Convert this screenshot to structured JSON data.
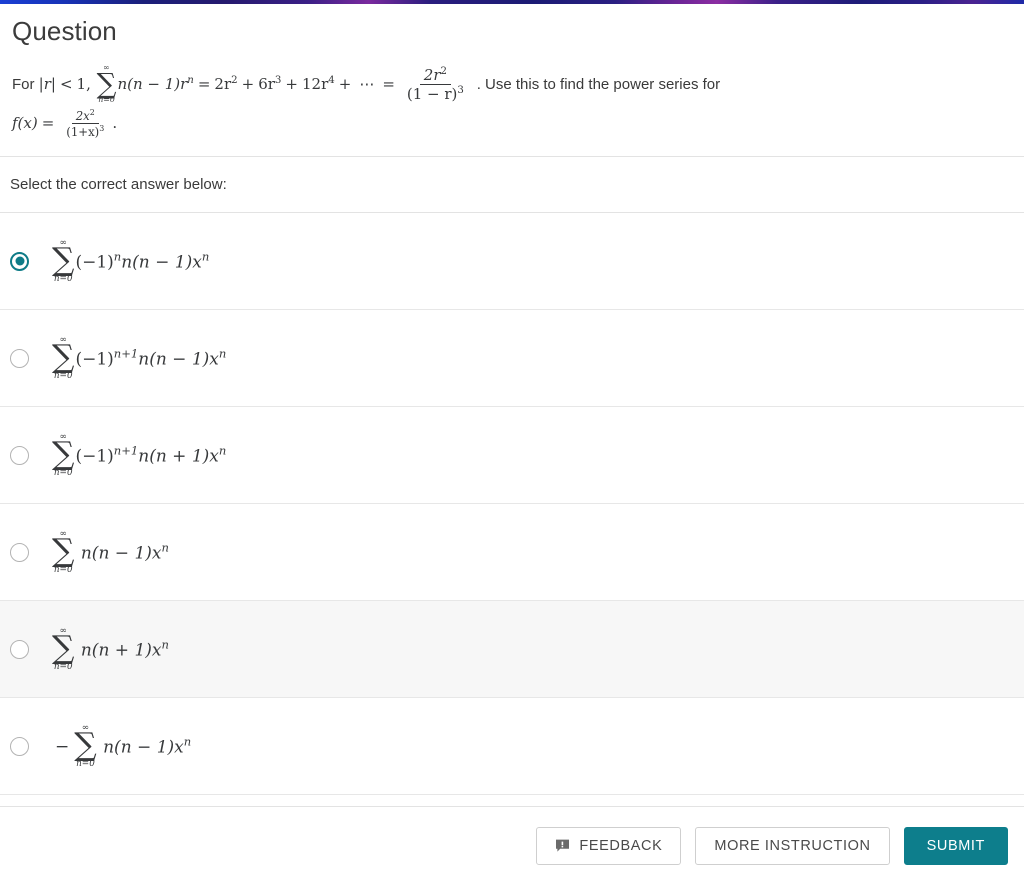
{
  "top_bar": {
    "gradient_from": "#1a3fd4",
    "gradient_mid": "#8b2da2",
    "gradient_to": "#1e2aa8"
  },
  "header": {
    "title": "Question"
  },
  "question": {
    "intro": "For",
    "condition_abs": "|r|",
    "condition_lt": "<",
    "condition_val": "1,",
    "sum_upper": "∞",
    "sum_lower": "n=0",
    "sum_sigma": "∑",
    "term_main": "n(n − 1)r",
    "term_main_sup": "n",
    "equals_1": "=",
    "series_t1": "2r",
    "series_t1_sup": "2",
    "plus_1": "+",
    "series_t2": "6r",
    "series_t2_sup": "3",
    "plus_2": "+",
    "series_t3": "12r",
    "series_t3_sup": "4",
    "plus_3": "+",
    "ellipsis": "⋯",
    "equals_2": "=",
    "frac_num": "2r",
    "frac_num_sup": "2",
    "frac_den": "(1 − r)",
    "frac_den_sup": "3",
    "sentence_tail": ". Use this to find the power series for",
    "fx_label": "f(x)",
    "fx_equals": "=",
    "fx_num": "2x",
    "fx_num_sup": "2",
    "fx_den": "(1+x)",
    "fx_den_sup": "3",
    "fx_period": "."
  },
  "prompt": {
    "text": "Select the correct answer below:"
  },
  "options": [
    {
      "id": "option-1",
      "selected": true,
      "hovered": false,
      "sum_upper": "∞",
      "sum_lower": "n=0",
      "prefix": "",
      "sign_base": "(−1)",
      "sign_exp": "n",
      "body": "n(n − 1)x",
      "body_sup": "n"
    },
    {
      "id": "option-2",
      "selected": false,
      "hovered": false,
      "sum_upper": "∞",
      "sum_lower": "n=0",
      "prefix": "",
      "sign_base": "(−1)",
      "sign_exp": "n+1",
      "body": "n(n − 1)x",
      "body_sup": "n"
    },
    {
      "id": "option-3",
      "selected": false,
      "hovered": false,
      "sum_upper": "∞",
      "sum_lower": "n=0",
      "prefix": "",
      "sign_base": "(−1)",
      "sign_exp": "n+1",
      "body": "n(n + 1)x",
      "body_sup": "n"
    },
    {
      "id": "option-4",
      "selected": false,
      "hovered": false,
      "sum_upper": "∞",
      "sum_lower": "n=0",
      "prefix": "",
      "sign_base": "",
      "sign_exp": "",
      "body": "n(n − 1)x",
      "body_sup": "n"
    },
    {
      "id": "option-5",
      "selected": false,
      "hovered": true,
      "sum_upper": "∞",
      "sum_lower": "n=0",
      "prefix": "",
      "sign_base": "",
      "sign_exp": "",
      "body": "n(n + 1)x",
      "body_sup": "n"
    },
    {
      "id": "option-6",
      "selected": false,
      "hovered": false,
      "sum_upper": "∞",
      "sum_lower": "n=0",
      "prefix": "−",
      "sign_base": "",
      "sign_exp": "",
      "body": "n(n − 1)x",
      "body_sup": "n"
    }
  ],
  "footer": {
    "feedback_label": "FEEDBACK",
    "feedback_icon": "comment-alert-icon",
    "more_instruction_label": "MORE INSTRUCTION",
    "submit_label": "SUBMIT",
    "submit_color": "#0d7e8c"
  }
}
